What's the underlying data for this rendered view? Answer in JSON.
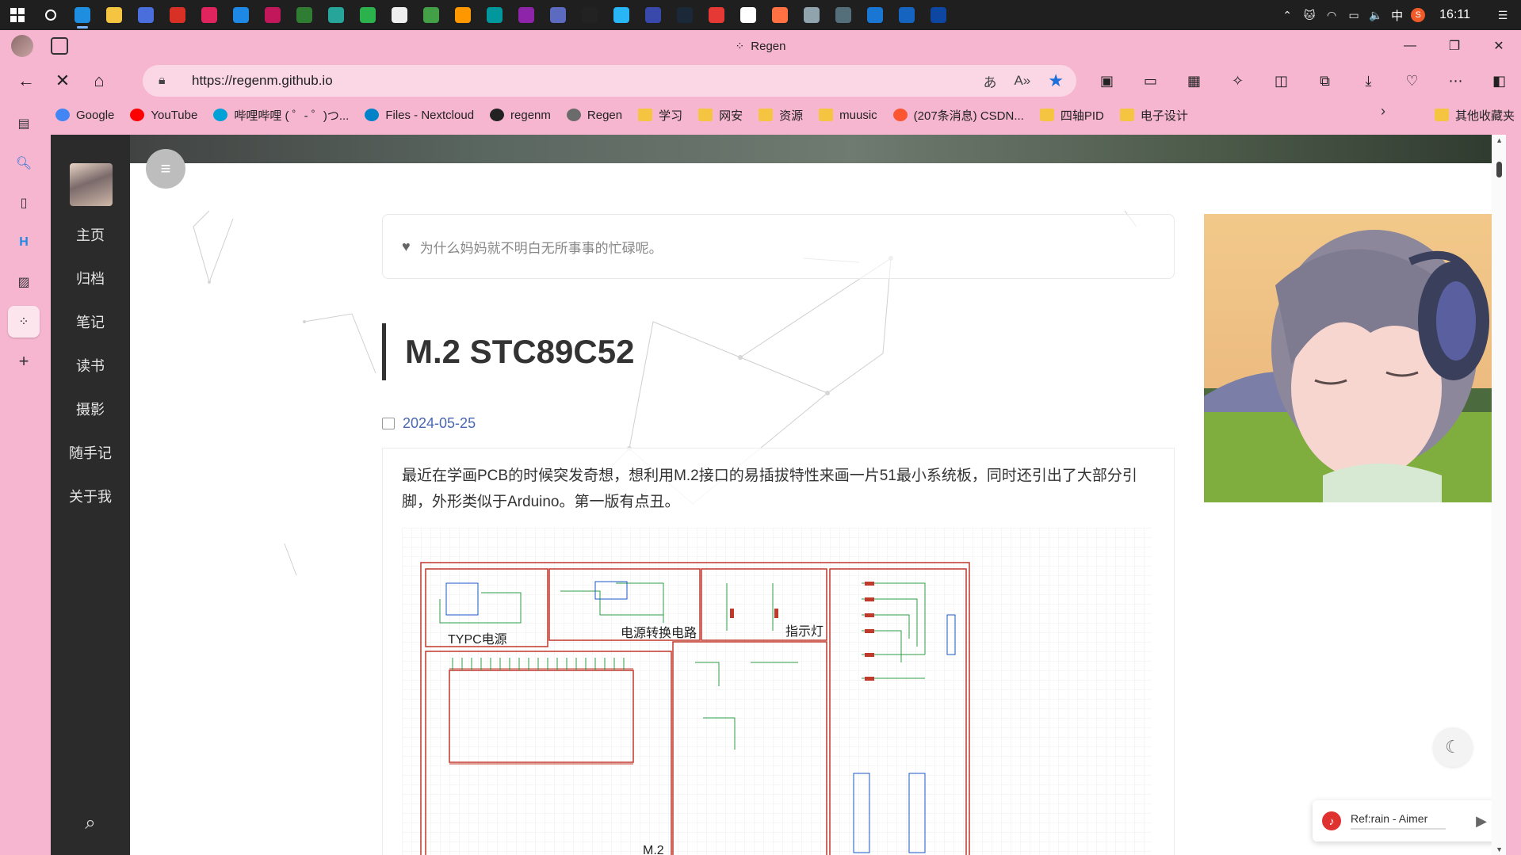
{
  "taskbar": {
    "apps": [
      {
        "name": "search-icon",
        "color": "#1f1f1f"
      },
      {
        "name": "edge-icon",
        "color": "#1e8fe0",
        "active": true
      },
      {
        "name": "file-explorer-icon",
        "color": "#f5c542"
      },
      {
        "name": "app-icon-3",
        "color": "#4a6fdc"
      },
      {
        "name": "wps-icon",
        "color": "#d93025"
      },
      {
        "name": "xmind-icon",
        "color": "#e0245e"
      },
      {
        "name": "vscode-icon",
        "color": "#1e88e5"
      },
      {
        "name": "app-icon-7",
        "color": "#c2185b"
      },
      {
        "name": "qt-icon",
        "color": "#2e7d32"
      },
      {
        "name": "app-icon-9",
        "color": "#26a69a"
      },
      {
        "name": "wechat-icon",
        "color": "#2bb24c"
      },
      {
        "name": "notepad-icon",
        "color": "#eeeeee"
      },
      {
        "name": "app-icon-12",
        "color": "#43a047"
      },
      {
        "name": "app-icon-13",
        "color": "#ff9800"
      },
      {
        "name": "arduino-icon",
        "color": "#00979d"
      },
      {
        "name": "app-icon-15",
        "color": "#8e24aa"
      },
      {
        "name": "app-icon-16",
        "color": "#5c6bc0"
      },
      {
        "name": "qq-icon",
        "color": "#222222"
      },
      {
        "name": "app-icon-18",
        "color": "#29b6f6"
      },
      {
        "name": "app-icon-19",
        "color": "#3949ab"
      },
      {
        "name": "steam-icon",
        "color": "#1b2838"
      },
      {
        "name": "netease-music-icon",
        "color": "#e53935"
      },
      {
        "name": "typora-icon",
        "color": "#ffffff"
      },
      {
        "name": "app-icon-23",
        "color": "#ff7043"
      },
      {
        "name": "app-icon-24",
        "color": "#90a4ae"
      },
      {
        "name": "app-icon-25",
        "color": "#546e7a"
      },
      {
        "name": "mobaxterm-icon",
        "color": "#1976d2"
      },
      {
        "name": "onedrive-icon",
        "color": "#1565c0"
      },
      {
        "name": "app-icon-28",
        "color": "#0d47a1"
      }
    ],
    "tray": {
      "ime": "中",
      "time": "16:11"
    }
  },
  "browser": {
    "tab_title": "Regen",
    "url": "https://regenm.github.io",
    "bookmarks": [
      {
        "label": "Google",
        "icon": "google-icon",
        "color": "#4285f4"
      },
      {
        "label": "YouTube",
        "icon": "youtube-icon",
        "color": "#ff0000"
      },
      {
        "label": "哔哩哔哩 ( ゜- ゜)つ...",
        "icon": "bilibili-icon",
        "color": "#00a1d6"
      },
      {
        "label": "Files - Nextcloud",
        "icon": "nextcloud-icon",
        "color": "#0082c9"
      },
      {
        "label": "regenm",
        "icon": "github-icon",
        "color": "#222222"
      },
      {
        "label": "Regen",
        "icon": "regen-avatar-icon",
        "color": "#6b6b6b"
      },
      {
        "label": "学习",
        "icon": "folder-icon",
        "color": "#f5c542"
      },
      {
        "label": "网安",
        "icon": "folder-icon",
        "color": "#f5c542"
      },
      {
        "label": "资源",
        "icon": "folder-icon",
        "color": "#f5c542"
      },
      {
        "label": "muusic",
        "icon": "folder-icon",
        "color": "#f5c542"
      },
      {
        "label": "(207条消息) CSDN...",
        "icon": "csdn-icon",
        "color": "#fc5531"
      },
      {
        "label": "四轴PID",
        "icon": "folder-icon",
        "color": "#f5c542"
      },
      {
        "label": "电子设计",
        "icon": "folder-icon",
        "color": "#f5c542"
      }
    ],
    "other_bookmarks": "其他收藏夹"
  },
  "site": {
    "nav": [
      "主页",
      "归档",
      "笔记",
      "读书",
      "摄影",
      "随手记",
      "关于我"
    ],
    "quote": "为什么妈妈就不明白无所事事的忙碌呢。",
    "post": {
      "title": "M.2 STC89C52",
      "date": "2024-05-25",
      "paragraph": "最近在学画PCB的时候突发奇想，想利用M.2接口的易插拔特性来画一片51最小系统板，同时还引出了大部分引脚，外形类似于Arduino。第一版有点丑。"
    },
    "schematic_labels": {
      "typec": "TYPC电源",
      "power": "电源转换电路",
      "led": "指示灯",
      "m2": "M.2"
    },
    "player": {
      "track": "Ref:rain - Aimer"
    }
  },
  "colors": {
    "chrome_pink": "#f7b6d0",
    "nav_dark": "#2b2b2b",
    "date_blue": "#4a67b5",
    "accent_star": "#1e6fd9"
  }
}
